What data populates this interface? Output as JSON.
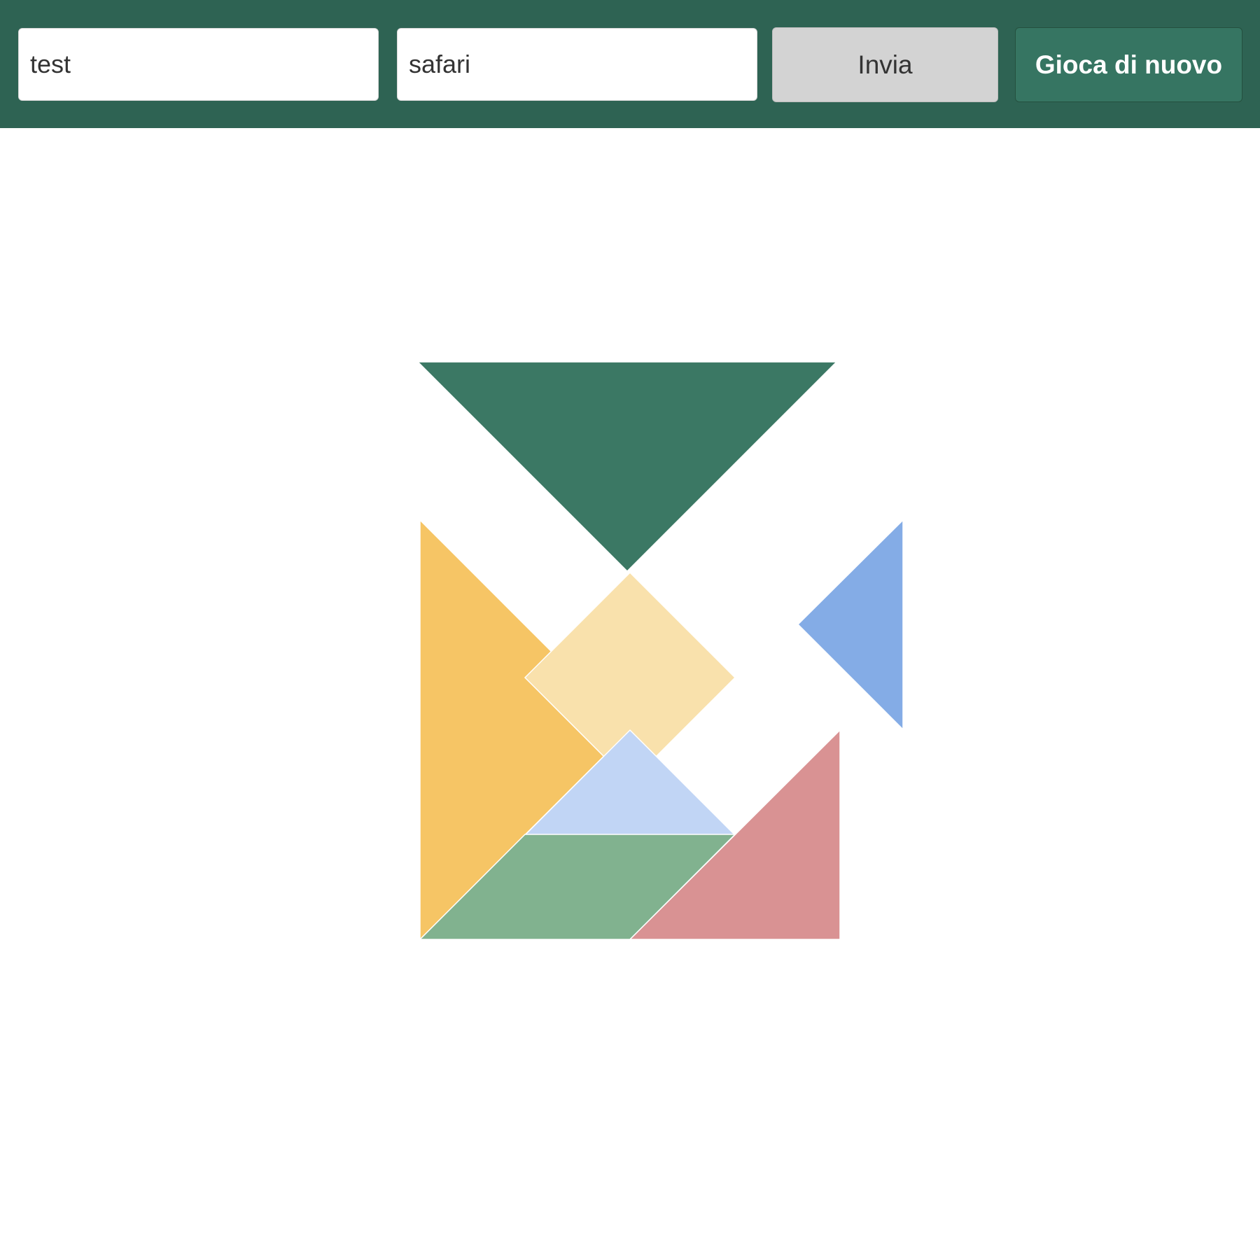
{
  "form": {
    "name_value": "test",
    "guess_value": "safari",
    "submit_label": "Invia",
    "replay_label": "Gioca di nuovo"
  },
  "colors": {
    "header_bg": "#2e6353",
    "replay_button_bg": "#367562",
    "submit_button_bg": "#d3d3d3"
  },
  "tangram": {
    "pieces": [
      {
        "name": "large-triangle-dark-green",
        "shape": "large-triangle",
        "color": "#3b7864"
      },
      {
        "name": "large-triangle-yellow",
        "shape": "large-triangle",
        "color": "#f6c565"
      },
      {
        "name": "square-light-yellow",
        "shape": "square",
        "color": "#f9e1ac"
      },
      {
        "name": "small-triangle-light-blue",
        "shape": "small-triangle",
        "color": "#c1d5f5"
      },
      {
        "name": "small-triangle-blue",
        "shape": "small-triangle",
        "color": "#84ace6"
      },
      {
        "name": "parallelogram-green",
        "shape": "parallelogram",
        "color": "#81b28f"
      },
      {
        "name": "medium-triangle-red",
        "shape": "medium-triangle",
        "color": "#d99293"
      }
    ]
  }
}
